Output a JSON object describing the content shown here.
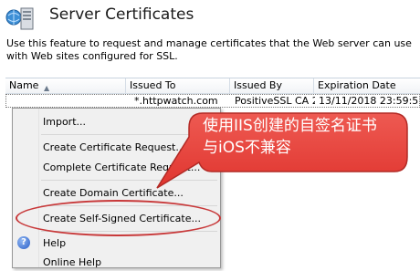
{
  "header": {
    "title": "Server Certificates"
  },
  "description": "Use this feature to request and manage certificates that the Web server can use with Web sites configured for SSL.",
  "table": {
    "columns": [
      "Name",
      "Issued To",
      "Issued By",
      "Expiration Date"
    ],
    "rows": [
      {
        "name": "",
        "issued_to": "*.httpwatch.com",
        "issued_by": "PositiveSSL CA 2",
        "expiration": "13/11/2018 23:59:5"
      }
    ]
  },
  "context_menu": {
    "import": "Import...",
    "create_request": "Create Certificate Request...",
    "complete_request": "Complete Certificate Request...",
    "create_domain": "Create Domain Certificate...",
    "create_self_signed": "Create Self-Signed Certificate...",
    "help": "Help",
    "online_help": "Online Help"
  },
  "callout": {
    "line1": "使用IIS创建的自签名证书",
    "line2": "与iOS不兼容"
  },
  "colors": {
    "callout_fill": "#e8413a",
    "callout_border": "#b22a25",
    "highlight_oval": "#c8393a"
  }
}
